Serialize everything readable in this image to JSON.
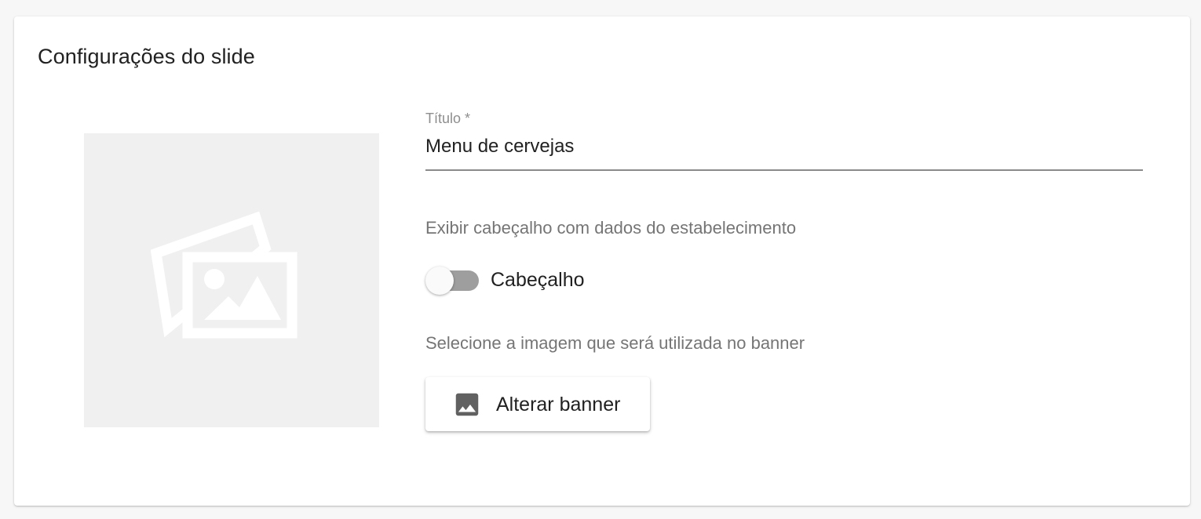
{
  "card": {
    "title": "Configurações do slide"
  },
  "preview": {
    "icon": "image-placeholder-icon",
    "background_color": "#f0f0f0"
  },
  "title_field": {
    "label": "Título *",
    "value": "Menu de cervejas"
  },
  "header_section": {
    "description": "Exibir cabeçalho com dados do estabelecimento",
    "toggle_label": "Cabeçalho",
    "toggle_on": false
  },
  "banner_section": {
    "description": "Selecione a imagem que será utilizada no banner",
    "button_label": "Alterar banner",
    "button_icon": "image-icon"
  },
  "colors": {
    "text_primary": "#212121",
    "text_secondary": "#757575",
    "toggle_track_off": "#9e9e9e"
  }
}
